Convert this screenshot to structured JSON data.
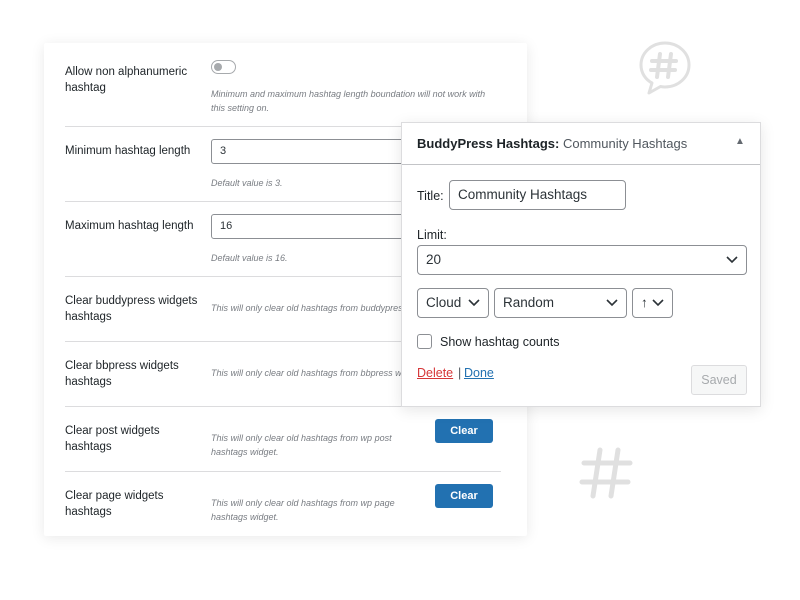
{
  "settings": {
    "rows": [
      {
        "label": "Allow non alphanumeric hashtag",
        "desc": "Minimum and maximum hashtag length boundation will not work with this setting on."
      },
      {
        "label": "Minimum hashtag length",
        "value": "3",
        "desc": "Default value is 3."
      },
      {
        "label": "Maximum hashtag length",
        "value": "16",
        "desc": "Default value is 16."
      },
      {
        "label": "Clear buddypress widgets hashtags",
        "desc": "This will only clear old hashtags from buddypress community widget."
      },
      {
        "label": "Clear bbpress widgets hashtags",
        "desc": "This will only clear old hashtags from bbpress widget."
      },
      {
        "label": "Clear post widgets hashtags",
        "desc": "This will only clear old hashtags from wp post hashtags widget.",
        "button": "Clear"
      },
      {
        "label": "Clear page widgets hashtags",
        "desc": "This will only clear old hashtags from wp page hashtags widget.",
        "button": "Clear"
      }
    ],
    "toggle_state": "off"
  },
  "widget": {
    "header_title": "BuddyPress Hashtags:",
    "header_subtitle": "Community Hashtags",
    "collapse_arrow": "▲",
    "title_label": "Title:",
    "title_value": "Community Hashtags",
    "limit_label": "Limit:",
    "limit_value": "20",
    "display_value": "Cloud",
    "order_value": "Random",
    "direction_value": "↑",
    "show_counts_label": "Show hashtag counts",
    "show_counts_checked": false,
    "delete_label": "Delete",
    "separator": "|",
    "done_label": "Done",
    "saved_label": "Saved"
  },
  "colors": {
    "primary_button": "#2271b1",
    "delete_link": "#d63638",
    "done_link": "#2271b1",
    "decor_icon": "#e0e0e0"
  },
  "icons": {
    "toggle": "toggle-switch",
    "bubble": "hashtag-chat-bubble-icon",
    "hash": "hashtag-icon",
    "chevron": "chevron-down-icon"
  }
}
